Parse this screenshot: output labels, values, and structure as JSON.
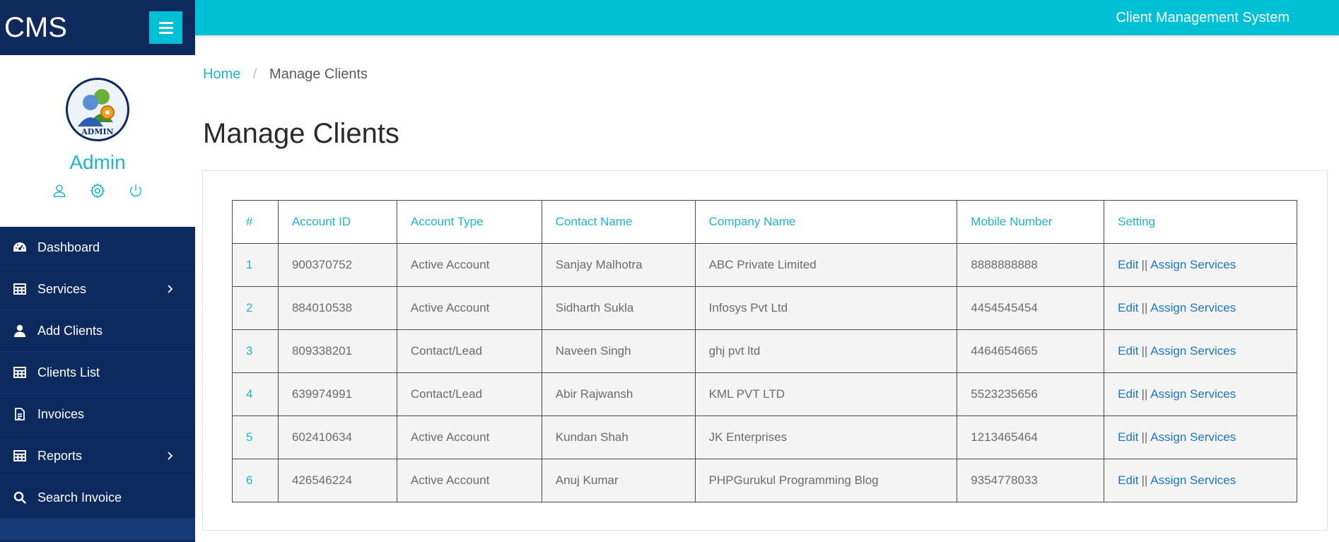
{
  "app": {
    "brand": "CMS",
    "top_title": "Client Management System"
  },
  "profile": {
    "avatar_label": "ADMIN",
    "name": "Admin",
    "icons": [
      "user-icon",
      "gear-icon",
      "power-icon"
    ]
  },
  "sidebar": {
    "items": [
      {
        "label": "Dashboard",
        "icon": "dashboard-icon",
        "has_submenu": false
      },
      {
        "label": "Services",
        "icon": "grid-icon",
        "has_submenu": true
      },
      {
        "label": "Add Clients",
        "icon": "user-icon",
        "has_submenu": false
      },
      {
        "label": "Clients List",
        "icon": "grid-icon",
        "has_submenu": false
      },
      {
        "label": "Invoices",
        "icon": "document-icon",
        "has_submenu": false
      },
      {
        "label": "Reports",
        "icon": "grid-icon",
        "has_submenu": true
      },
      {
        "label": "Search Invoice",
        "icon": "search-icon",
        "has_submenu": false
      }
    ]
  },
  "breadcrumb": {
    "home": "Home",
    "separator": "/",
    "current": "Manage Clients"
  },
  "page": {
    "title": "Manage Clients"
  },
  "table": {
    "headers": [
      "#",
      "Account ID",
      "Account Type",
      "Contact Name",
      "Company Name",
      "Mobile Number",
      "Setting"
    ],
    "rows": [
      {
        "idx": "1",
        "account_id": "900370752",
        "account_type": "Active Account",
        "contact": "Sanjay Malhotra",
        "company": "ABC Private Limited",
        "mobile": "8888888888"
      },
      {
        "idx": "2",
        "account_id": "884010538",
        "account_type": "Active Account",
        "contact": "Sidharth Sukla",
        "company": "Infosys Pvt Ltd",
        "mobile": "4454545454"
      },
      {
        "idx": "3",
        "account_id": "809338201",
        "account_type": "Contact/Lead",
        "contact": "Naveen Singh",
        "company": "ghj pvt ltd",
        "mobile": "4464654665"
      },
      {
        "idx": "4",
        "account_id": "639974991",
        "account_type": "Contact/Lead",
        "contact": "Abir Rajwansh",
        "company": "KML PVT LTD",
        "mobile": "5523235656"
      },
      {
        "idx": "5",
        "account_id": "602410634",
        "account_type": "Active Account",
        "contact": "Kundan Shah",
        "company": "JK Enterprises",
        "mobile": "1213465464"
      },
      {
        "idx": "6",
        "account_id": "426546224",
        "account_type": "Active Account",
        "contact": "Anuj Kumar",
        "company": "PHPGurukul Programming Blog",
        "mobile": "9354778033"
      }
    ],
    "edit_label": "Edit",
    "pipe_label": "||",
    "assign_label": "Assign Services"
  },
  "colors": {
    "sidebar_bg": "#0d2a5e",
    "accent": "#00c0d6",
    "link": "#1b76c8"
  }
}
